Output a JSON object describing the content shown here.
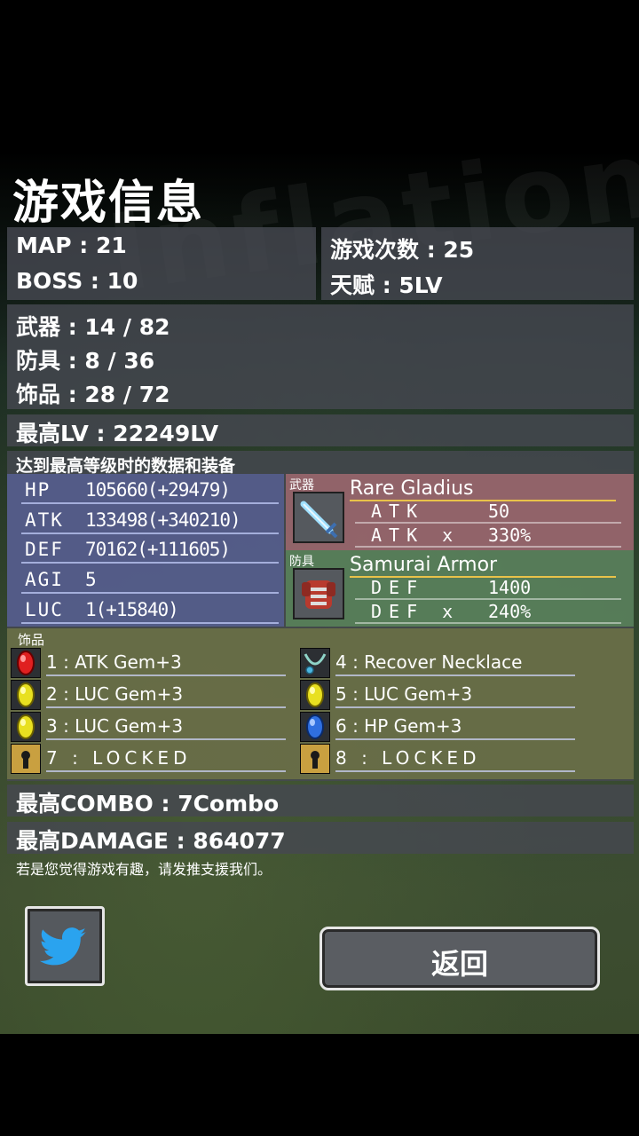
{
  "title": "游戏信息",
  "watermark": "Inflation",
  "summary": {
    "map": "MAP : 21",
    "boss": "BOSS : 10",
    "play_count": "游戏次数 : 25",
    "talent": "天赋 : 5LV"
  },
  "collection": {
    "weapon": "武器 : 14 / 82",
    "armor": "防具 : 8 / 36",
    "accessory": "饰品 : 28 / 72"
  },
  "max_level": "最高LV : 22249LV",
  "max_level_section_label": "达到最高等级时的数据和装备",
  "stats": [
    {
      "key": "HP",
      "value": "105660(+29479)"
    },
    {
      "key": "ATK",
      "value": "133498(+340210)"
    },
    {
      "key": "DEF",
      "value": "70162(+111605)"
    },
    {
      "key": "AGI",
      "value": "5"
    },
    {
      "key": "LUC",
      "value": "1(+15840)"
    }
  ],
  "weapon": {
    "label": "武器",
    "name": "Rare Gladius",
    "icon": "sword-icon",
    "lines": [
      {
        "key": "ATK",
        "value": "50"
      },
      {
        "key": "ATK x",
        "value": "330%"
      }
    ]
  },
  "armor": {
    "label": "防具",
    "name": "Samurai Armor",
    "icon": "armor-icon",
    "lines": [
      {
        "key": "DEF",
        "value": "1400"
      },
      {
        "key": "DEF x",
        "value": "240%"
      }
    ]
  },
  "accessories": {
    "label": "饰品",
    "items": [
      {
        "text": "1 : ATK Gem+3",
        "icon": "red-gem-icon"
      },
      {
        "text": "4 : Recover Necklace",
        "icon": "necklace-icon"
      },
      {
        "text": "2 : LUC Gem+3",
        "icon": "yellow-gem-icon"
      },
      {
        "text": "5 : LUC Gem+3",
        "icon": "yellow-gem-icon"
      },
      {
        "text": "3 : LUC Gem+3",
        "icon": "yellow-gem-icon"
      },
      {
        "text": "6 : HP Gem+3",
        "icon": "blue-gem-icon"
      },
      {
        "text": "7 : LOCKED",
        "icon": "lock-icon"
      },
      {
        "text": "8 : LOCKED",
        "icon": "lock-icon"
      }
    ]
  },
  "max_combo": "最高COMBO : 7Combo",
  "max_damage": "最高DAMAGE : 864077",
  "hint": "若是您觉得游戏有趣，请发推支援我们。",
  "buttons": {
    "back": "返回",
    "twitter_icon": "twitter-bird-icon"
  },
  "colors": {
    "stats_bg": "#5a64a0",
    "weapon_bg": "#a86c72",
    "armor_bg": "#5c8a5c",
    "accessory_bg": "#787d46",
    "gold_underline": "#e9c24a",
    "twitter_blue": "#2aa3ef"
  }
}
